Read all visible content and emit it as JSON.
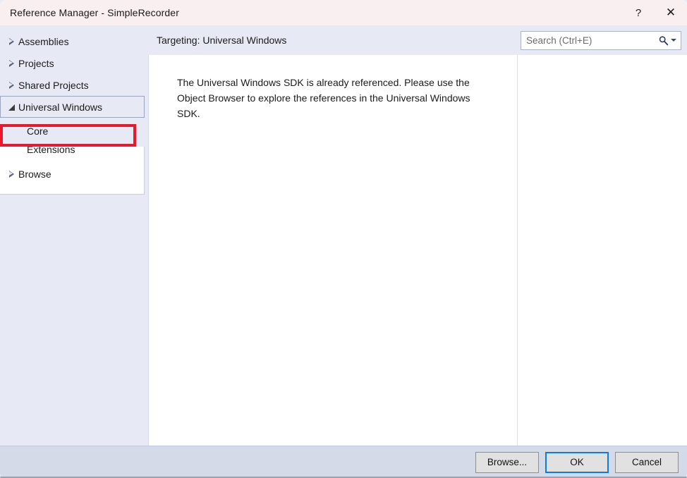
{
  "window": {
    "title": "Reference Manager - SimpleRecorder",
    "help_label": "?",
    "close_label": "✕"
  },
  "sidebar": {
    "items": [
      {
        "label": "Assemblies",
        "state": "collapsed",
        "icon": "chevron-right-icon"
      },
      {
        "label": "Projects",
        "state": "collapsed",
        "icon": "chevron-right-icon"
      },
      {
        "label": "Shared Projects",
        "state": "collapsed",
        "icon": "chevron-right-icon"
      },
      {
        "label": "Universal Windows",
        "state": "expanded",
        "icon": "chevron-down-icon",
        "selected": true,
        "highlighted": true
      },
      {
        "label": "Browse",
        "state": "collapsed",
        "icon": "chevron-right-icon"
      }
    ],
    "subitems": [
      {
        "label": "Core"
      },
      {
        "label": "Extensions"
      }
    ]
  },
  "header": {
    "targeting_label": "Targeting: Universal Windows",
    "search": {
      "placeholder": "Search (Ctrl+E)",
      "value": "",
      "icon": "search-icon",
      "dropdown_icon": "chevron-down-icon"
    }
  },
  "content": {
    "message": "The Universal Windows SDK is already referenced. Please use the Object Browser to explore the references in the Universal Windows SDK."
  },
  "footer": {
    "browse_label": "Browse...",
    "ok_label": "OK",
    "cancel_label": "Cancel"
  },
  "colors": {
    "titlebar_bg": "#faeff0",
    "dialog_bg": "#e7eaf4",
    "content_bg": "#ffffff",
    "footer_bg": "#d5dae9",
    "highlight_red": "#e8192c",
    "focus_blue": "#0d7ed7"
  }
}
